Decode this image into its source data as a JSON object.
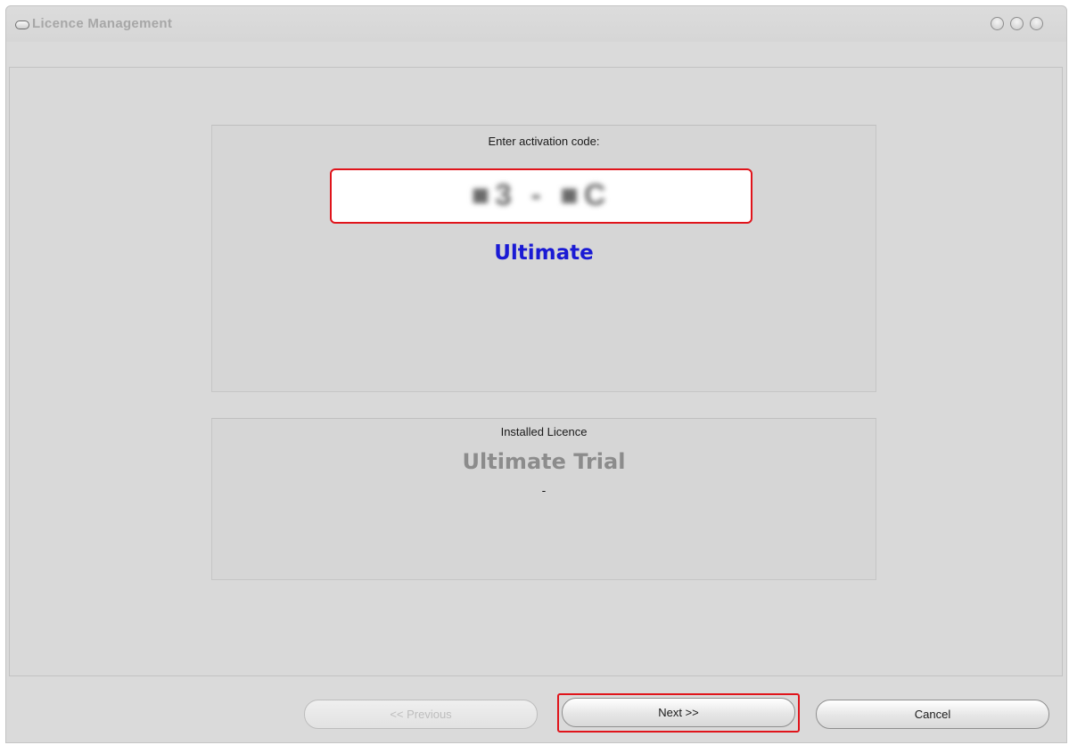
{
  "window": {
    "title": "Licence Management"
  },
  "activation": {
    "label": "Enter activation code:",
    "code_value": "■3 - ■C",
    "edition": "Ultimate",
    "edition_color": "#1a1ad4"
  },
  "installed": {
    "label": "Installed Licence",
    "edition": "Ultimate Trial",
    "edition_color": "#8c8c8c",
    "detail": "-"
  },
  "buttons": {
    "previous": "<< Previous",
    "next": "Next >>",
    "cancel": "Cancel"
  },
  "highlight_color": "#e0141b"
}
